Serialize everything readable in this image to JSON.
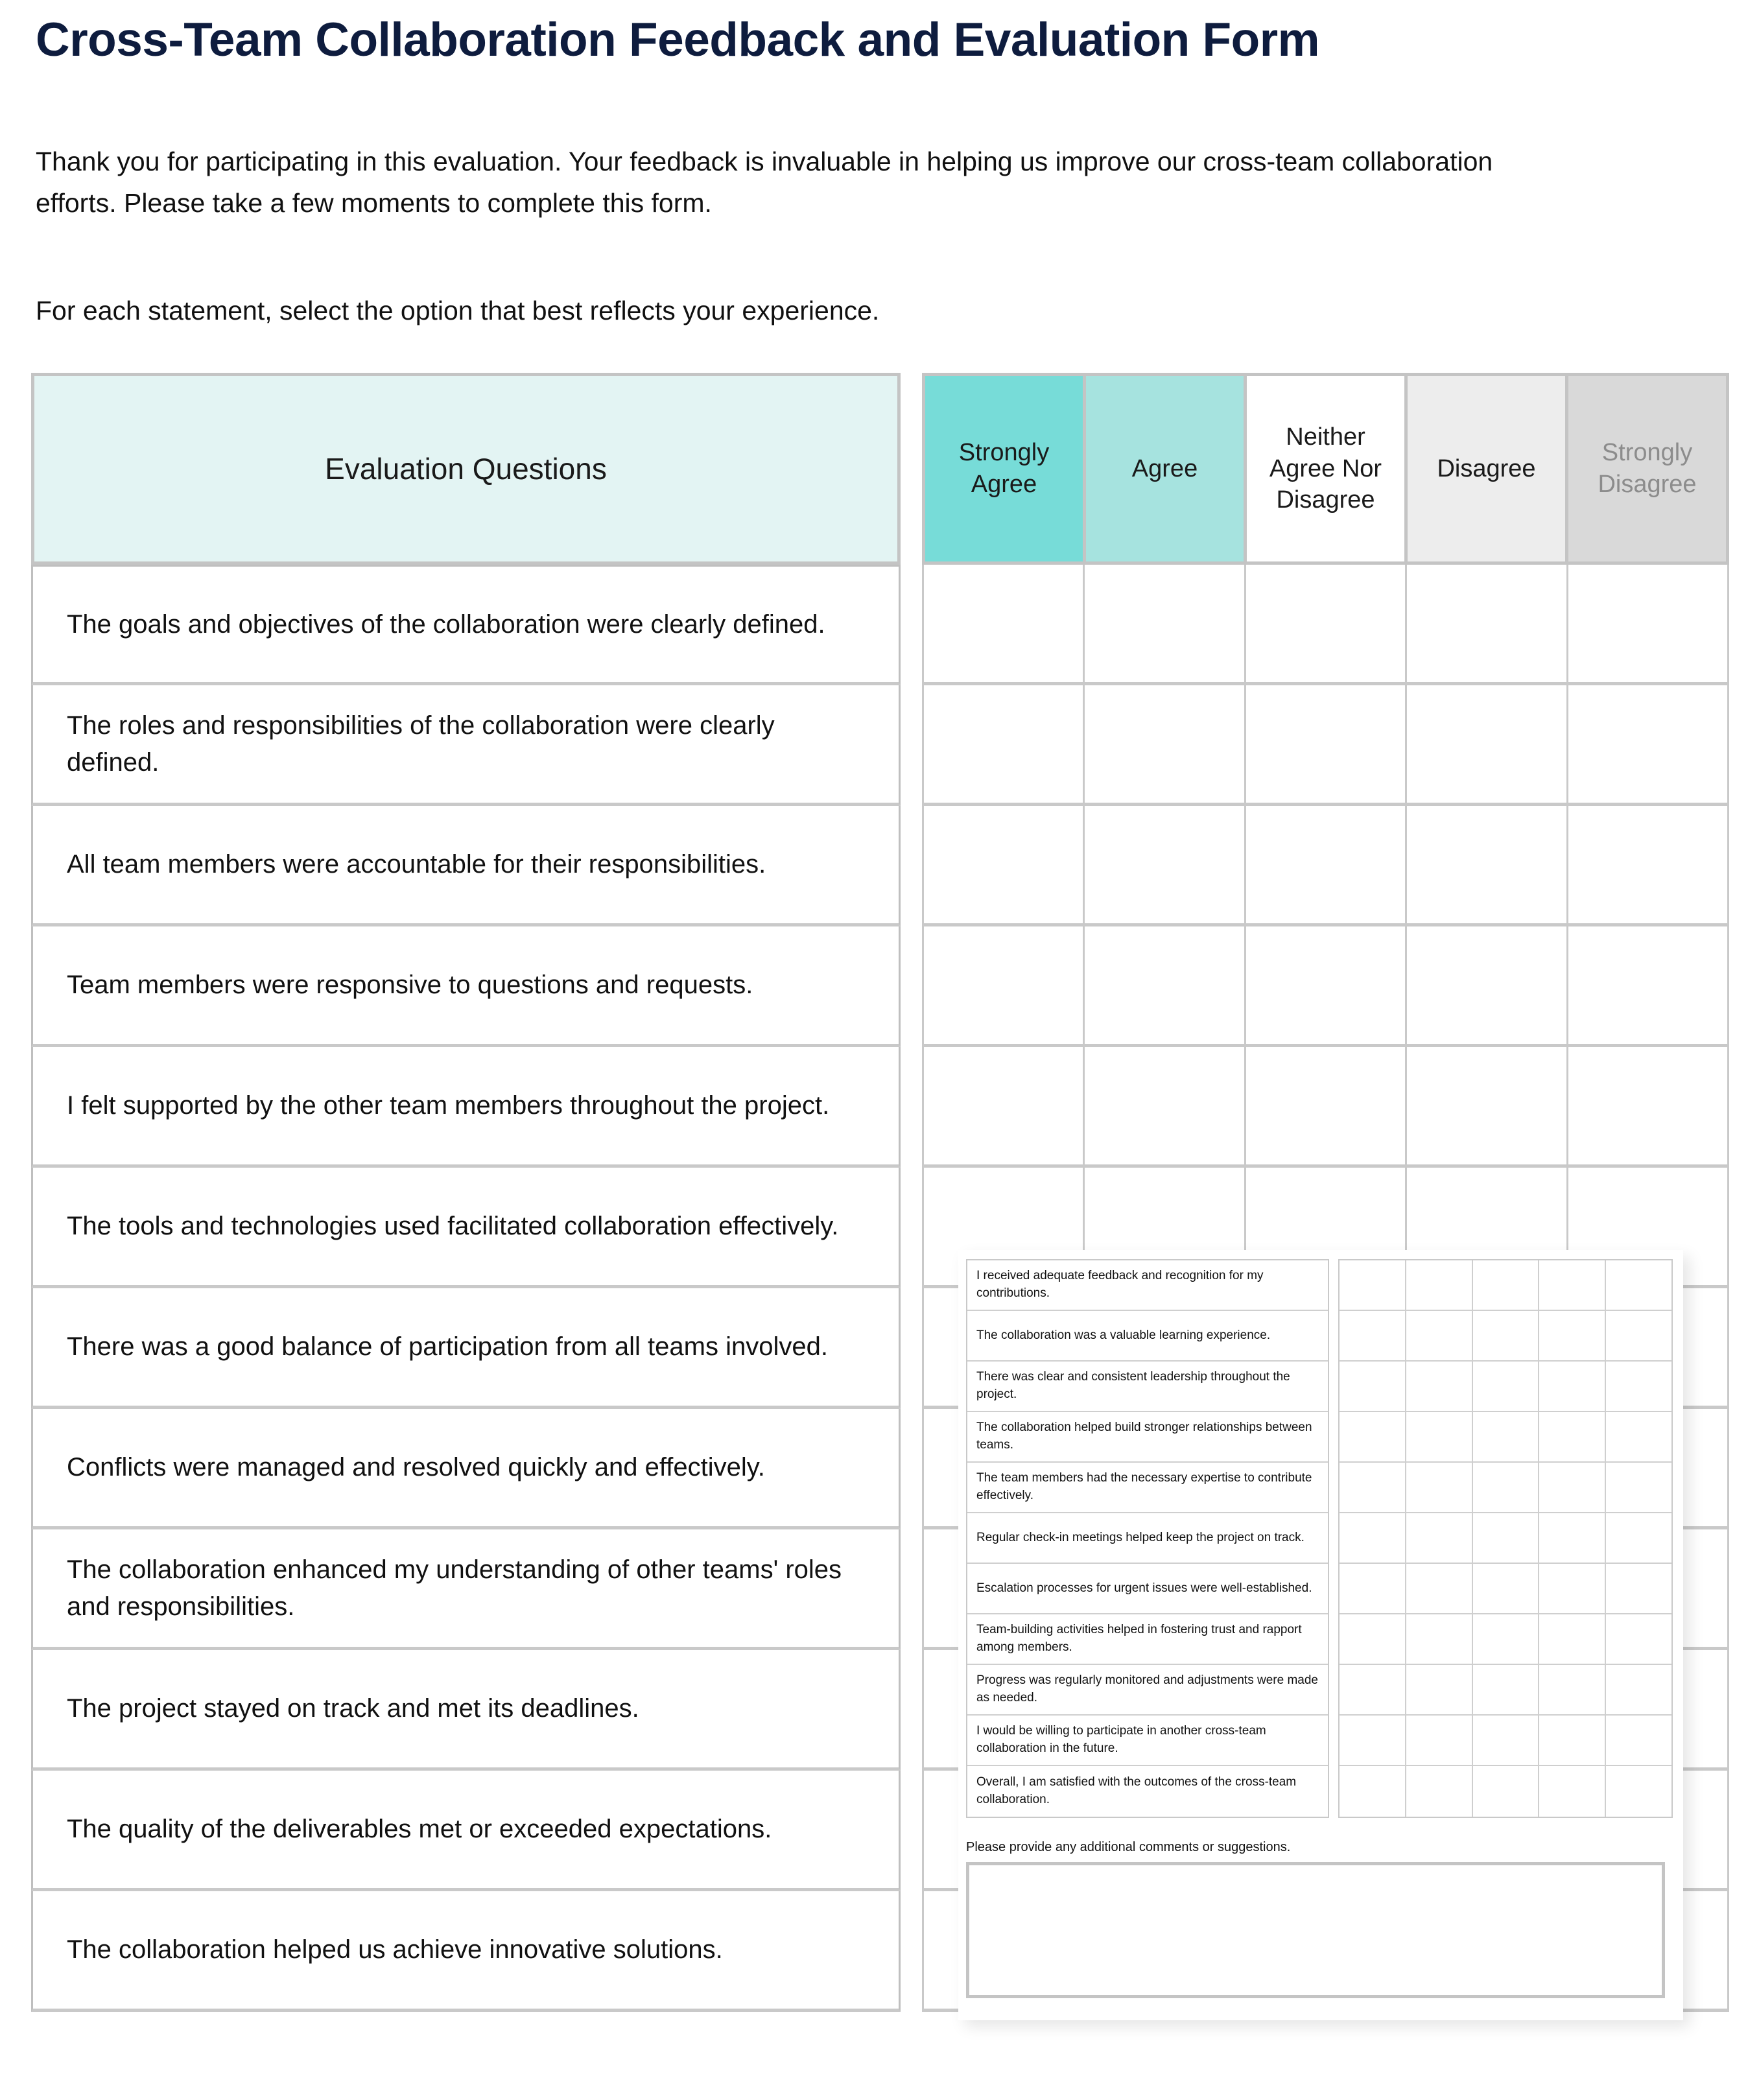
{
  "document": {
    "title": "Cross-Team Collaboration Feedback and Evaluation Form",
    "intro": "Thank you for participating in this evaluation. Your feedback is invaluable in helping us improve our cross-team collaboration efforts. Please take a few moments to complete this form.",
    "instruction": "For each statement, select the option that best reflects your experience."
  },
  "colors": {
    "title": "#0E1C3E",
    "questions_header_bg": "#E3F4F3",
    "strongly_agree_bg": "#77DCD8",
    "agree_bg": "#A6E3DF",
    "neither_bg": "#FFFFFF",
    "disagree_bg": "#EDEDED",
    "strongly_disagree_bg": "#D9D9D9",
    "border": "#C4C4C4"
  },
  "matrix": {
    "questions_header": "Evaluation Questions",
    "scale": [
      {
        "label": "Strongly Agree",
        "bg": "#77DCD8",
        "color": "#1A1A1A"
      },
      {
        "label": "Agree",
        "bg": "#A6E3DF",
        "color": "#1A1A1A"
      },
      {
        "label": "Neither Agree Nor Disagree",
        "bg": "#FFFFFF",
        "color": "#1A1A1A"
      },
      {
        "label": "Disagree",
        "bg": "#EDEDED",
        "color": "#1A1A1A"
      },
      {
        "label": "Strongly Disagree",
        "bg": "#D9D9D9",
        "color": "#8C8C8C"
      }
    ],
    "questions": [
      {
        "text": "The goals and objectives of the collaboration were clearly defined.",
        "height": 186
      },
      {
        "text": "The roles and responsibilities of the collaboration were clearly defined.",
        "height": 186
      },
      {
        "text": "All team members were accountable for their responsibilities.",
        "height": 186
      },
      {
        "text": "Team members were responsive to questions and requests.",
        "height": 186
      },
      {
        "text": "I felt supported by the other team members throughout the project.",
        "height": 186
      },
      {
        "text": "The tools and technologies used facilitated collaboration effectively.",
        "height": 186
      },
      {
        "text": "There was a good balance of participation from all teams involved.",
        "height": 186
      },
      {
        "text": "Conflicts were managed and resolved quickly and effectively.",
        "height": 186
      },
      {
        "text": "The collaboration enhanced my understanding of other teams' roles and responsibilities.",
        "height": 186
      },
      {
        "text": "The project stayed on track and met its deadlines.",
        "height": 186
      },
      {
        "text": "The quality of the deliverables met or exceeded expectations.",
        "height": 186
      },
      {
        "text": "The collaboration helped us achieve innovative solutions.",
        "height": 186
      }
    ]
  },
  "inset": {
    "questions": [
      "I received adequate feedback and recognition for my contributions.",
      "The collaboration was a valuable learning experience.",
      "There was clear and consistent leadership throughout the project.",
      "The collaboration helped build stronger relationships between teams.",
      "The team members had the necessary expertise to contribute effectively.",
      "Regular check-in meetings helped keep the project on track.",
      "Escalation processes for urgent issues were well-established.",
      "Team-building activities helped in fostering trust and rapport among members.",
      "Progress was regularly monitored and adjustments were made as needed.",
      "I would be willing to participate in another cross-team collaboration in the future.",
      "Overall, I am satisfied with the outcomes of the cross-team collaboration."
    ],
    "comment_label": "Please provide any additional comments or suggestions.",
    "comment_value": ""
  }
}
